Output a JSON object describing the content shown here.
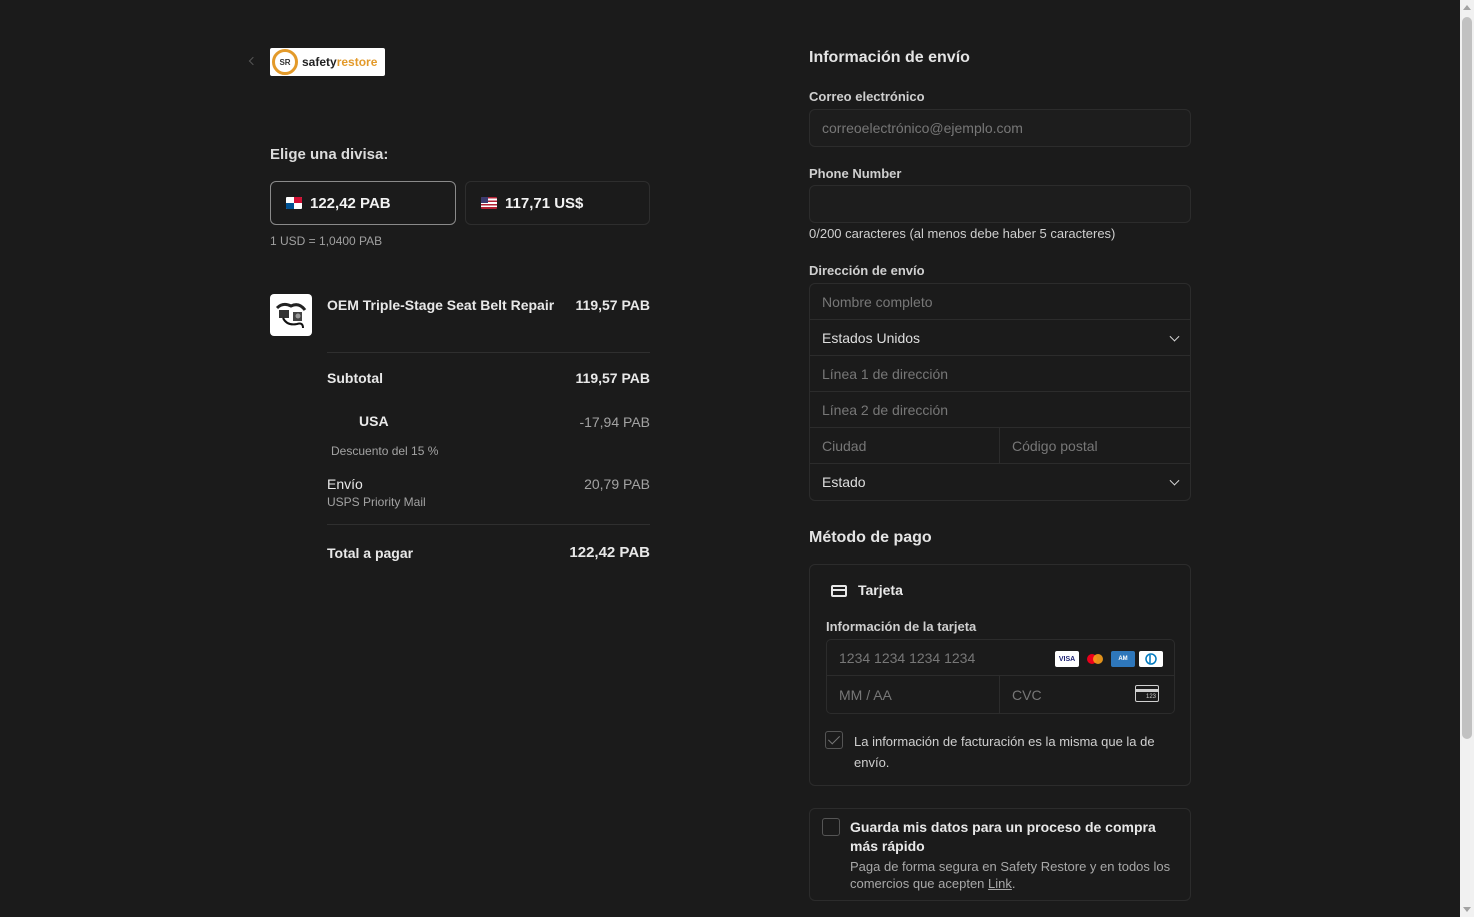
{
  "brand": {
    "logo_name": "safetyrestore",
    "logo_prefix": "safety",
    "logo_suffix": "restore",
    "logo_badge": "SR"
  },
  "currency": {
    "title": "Elige una divisa:",
    "options": [
      {
        "label": "122,42 PAB",
        "flag": "panama-flag",
        "selected": true
      },
      {
        "label": "117,71 US$",
        "flag": "us-flag",
        "selected": false
      }
    ],
    "rate": "1 USD = 1,0400 PAB"
  },
  "order": {
    "product": {
      "name": "OEM Triple-Stage Seat Belt Repair",
      "price": "119,57 PAB"
    },
    "subtotal_label": "Subtotal",
    "subtotal": "119,57 PAB",
    "discount": {
      "code": "USA",
      "amount": "-17,94 PAB",
      "description": "Descuento del 15 %"
    },
    "shipping": {
      "label": "Envío",
      "method": "USPS Priority Mail",
      "amount": "20,79 PAB"
    },
    "total_label": "Total a pagar",
    "total": "122,42 PAB"
  },
  "shipping_info": {
    "title": "Información de envío",
    "email_label": "Correo electrónico",
    "email_placeholder": "correoelectrónico@ejemplo.com",
    "phone_label": "Phone Number",
    "phone_value": "",
    "phone_hint": "0/200 caracteres (al menos debe haber 5 caracteres)",
    "address_label": "Dirección de envío",
    "name_placeholder": "Nombre completo",
    "country": "Estados Unidos",
    "line1_placeholder": "Línea 1 de dirección",
    "line2_placeholder": "Línea 2 de dirección",
    "city_placeholder": "Ciudad",
    "zip_placeholder": "Código postal",
    "state_placeholder": "Estado"
  },
  "payment": {
    "title": "Método de pago",
    "tab_label": "Tarjeta",
    "card_info_label": "Información de la tarjeta",
    "card_number_placeholder": "1234 1234 1234 1234",
    "expiry_placeholder": "MM / AA",
    "cvc_placeholder": "CVC",
    "card_brands": [
      "VISA",
      "mastercard",
      "amex",
      "diners"
    ],
    "billing_same_text": "La información de facturación es la misma que la de envío.",
    "billing_same_checked": true
  },
  "save_info": {
    "title": "Guarda mis datos para un proceso de compra más rápido",
    "subtitle_prefix": "Paga de forma segura en Safety Restore y en todos los comercios que acepten ",
    "link_text": "Link",
    "subtitle_suffix": "."
  },
  "colors": {
    "background": "#1b1b1b",
    "border": "#2c2c2c",
    "accent_logo": "#e39a2a"
  }
}
